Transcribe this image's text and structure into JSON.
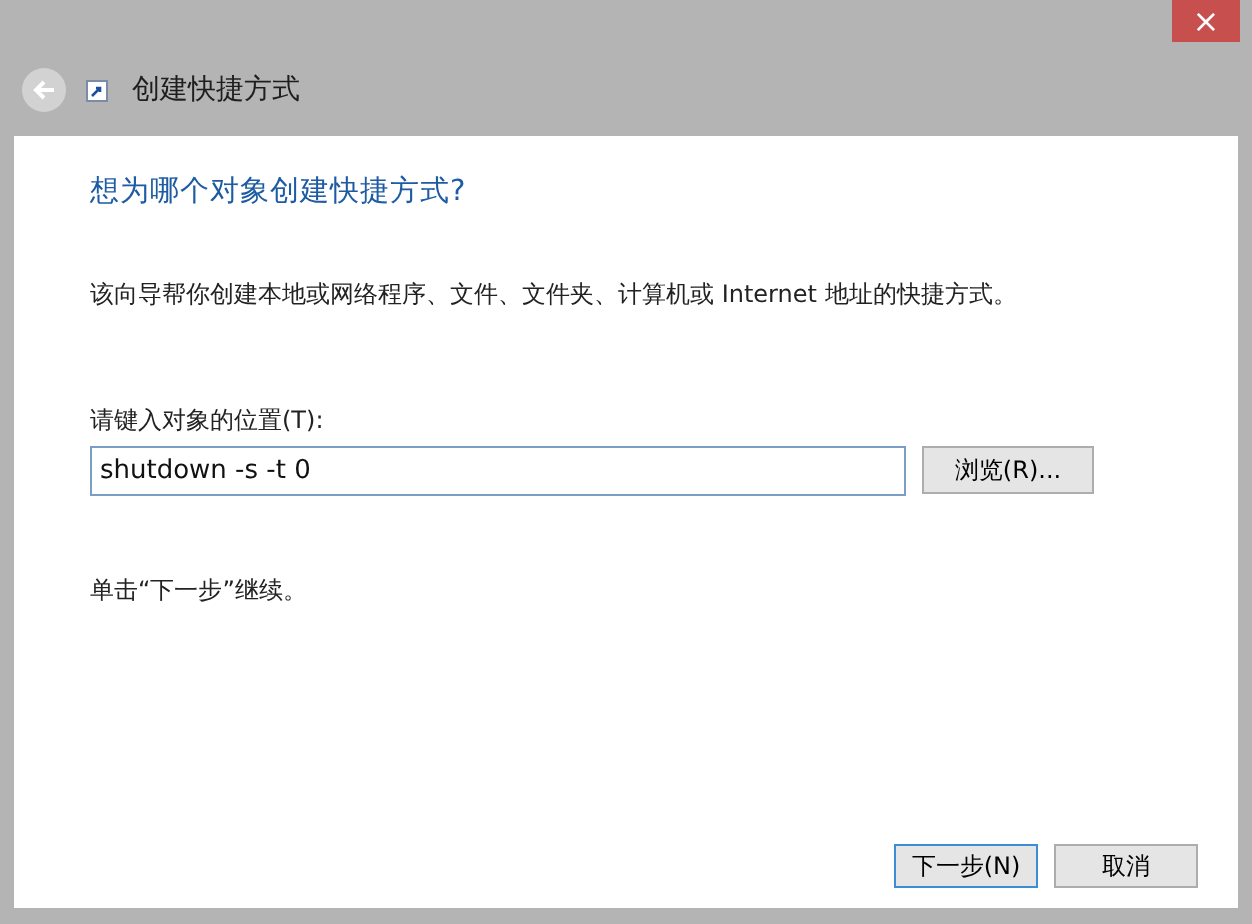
{
  "window": {
    "title": "创建快捷方式",
    "close": "×"
  },
  "heading": "想为哪个对象创建快捷方式?",
  "description": "该向导帮你创建本地或网络程序、文件、文件夹、计算机或 Internet 地址的快捷方式。",
  "location": {
    "label": "请键入对象的位置(T):",
    "value": "shutdown -s -t 0",
    "browse": "浏览(R)..."
  },
  "hint": "单击“下一步”继续。",
  "buttons": [
    {
      "label": "下一步(N)",
      "default": true
    },
    {
      "label": "取消",
      "default": false
    }
  ]
}
